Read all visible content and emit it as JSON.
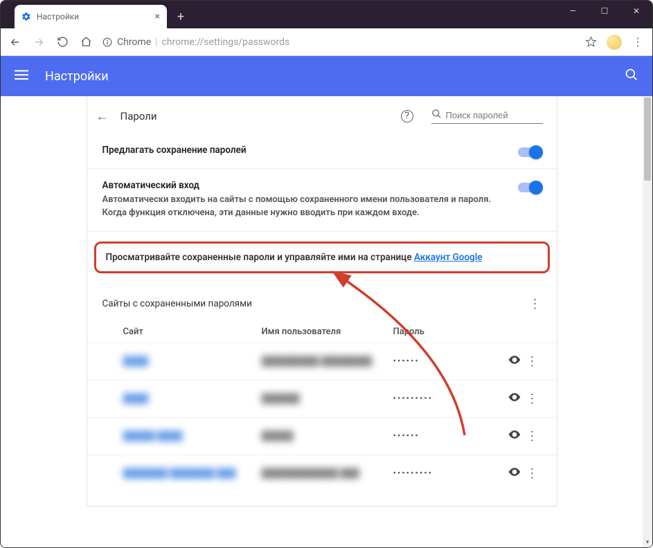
{
  "window": {
    "tab_title": "Настройки",
    "url_scheme": "Chrome",
    "url": "chrome://settings/passwords"
  },
  "header": {
    "title": "Настройки"
  },
  "card": {
    "title": "Пароли",
    "search_placeholder": "Поиск паролей",
    "offer_save": {
      "label": "Предлагать сохранение паролей"
    },
    "auto_signin": {
      "label": "Автоматический вход",
      "desc": "Автоматически входить на сайты с помощью сохраненного имени пользователя и пароля. Когда функция отключена, эти данные нужно вводить при каждом входе."
    },
    "manage": {
      "text": "Просматривайте сохраненные пароли и управляйте ими на странице ",
      "link": "Аккаунт Google"
    },
    "saved_list_title": "Сайты с сохраненными паролями",
    "columns": {
      "site": "Сайт",
      "user": "Имя пользователя",
      "pass": "Пароль"
    },
    "rows": [
      {
        "site": "████",
        "user": "█████████ ████████",
        "pass": "••••••"
      },
      {
        "site": "████",
        "user": "██████",
        "pass": "•••••••••"
      },
      {
        "site": "█████ ████",
        "user": "█████",
        "pass": "••••••"
      },
      {
        "site": "███████ ███████ ███",
        "user": "████████████ ███",
        "pass": "•••••••••"
      }
    ]
  }
}
